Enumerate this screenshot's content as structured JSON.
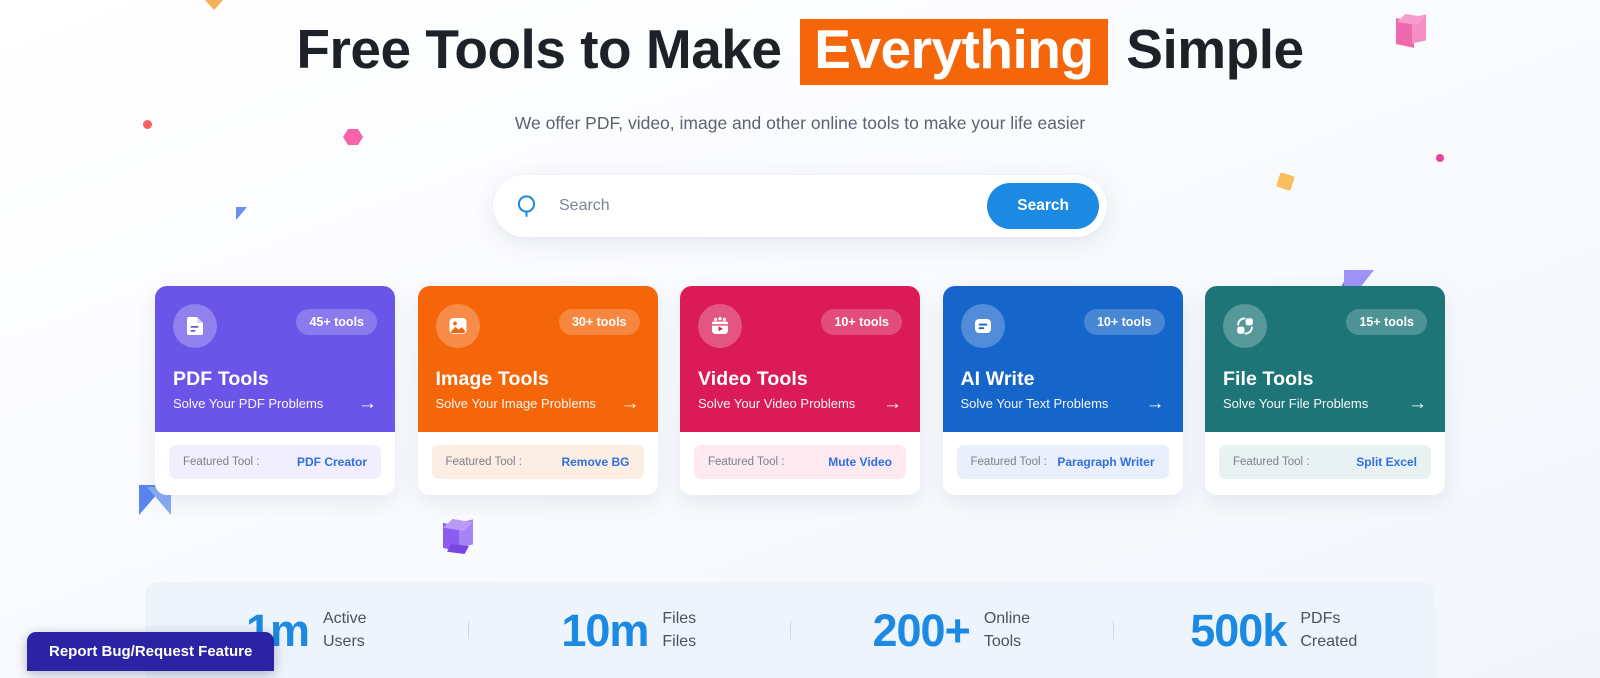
{
  "hero": {
    "headline_part1": "Free Tools to Make",
    "headline_highlight": "Everything",
    "headline_part2": "Simple",
    "subtitle": "We offer PDF, video, image and other online tools to make your life easier"
  },
  "search": {
    "placeholder": "Search",
    "button_label": "Search",
    "icon": "search-icon",
    "accent": "#1c8ae3"
  },
  "cards": [
    {
      "title": "PDF Tools",
      "subtitle": "Solve Your PDF Problems",
      "badge": "45+ tools",
      "featured_label": "Featured Tool :",
      "featured_value": "PDF Creator",
      "icon": "document-icon",
      "color": "#6b55e8",
      "foot_bg": "#f1effd",
      "foot_value_color": "#2f6fe0",
      "arrow": "→"
    },
    {
      "title": "Image Tools",
      "subtitle": "Solve Your Image Problems",
      "badge": "30+ tools",
      "featured_label": "Featured Tool :",
      "featured_value": "Remove BG",
      "icon": "image-icon",
      "color": "#f5650a",
      "foot_bg": "#fdeee3",
      "foot_value_color": "#2f6fe0",
      "arrow": "→"
    },
    {
      "title": "Video Tools",
      "subtitle": "Solve Your Video Problems",
      "badge": "10+ tools",
      "featured_label": "Featured Tool :",
      "featured_value": "Mute Video",
      "icon": "video-icon",
      "color": "#da1b57",
      "foot_bg": "#fdeaf0",
      "foot_value_color": "#2f6fe0",
      "arrow": "→"
    },
    {
      "title": "AI Write",
      "subtitle": "Solve Your Text Problems",
      "badge": "10+ tools",
      "featured_label": "Featured Tool :",
      "featured_value": "Paragraph Writer",
      "icon": "text-lines-icon",
      "color": "#1565cb",
      "foot_bg": "#e9f0fb",
      "foot_value_color": "#2f6fe0",
      "arrow": "→"
    },
    {
      "title": "File Tools",
      "subtitle": "Solve Your File Problems",
      "badge": "15+ tools",
      "featured_label": "Featured Tool :",
      "featured_value": "Split Excel",
      "icon": "file-convert-icon",
      "color": "#1d7578",
      "foot_bg": "#e8f2f3",
      "foot_value_color": "#2f6fe0",
      "arrow": "→"
    }
  ],
  "stats": [
    {
      "value": "1m",
      "label_line1": "Active",
      "label_line2": "Users"
    },
    {
      "value": "10m",
      "label_line1": "Files",
      "label_line2": "Files"
    },
    {
      "value": "200+",
      "label_line1": "Online",
      "label_line2": "Tools"
    },
    {
      "value": "500k",
      "label_line1": "PDFs",
      "label_line2": "Created"
    }
  ],
  "report_badge": {
    "label": "Report Bug/Request Feature",
    "color": "#2b23a3"
  },
  "decorations": [
    {
      "name": "orange-triangle",
      "color": "#f7b15b"
    },
    {
      "name": "red-dot",
      "color": "#fb5f5f"
    },
    {
      "name": "pink-hexagon",
      "color": "#f564a9"
    },
    {
      "name": "blue-triangle",
      "color": "#6b8cf0"
    },
    {
      "name": "pink-cube",
      "color": "#f26bb0"
    },
    {
      "name": "pink-dot",
      "color": "#ec3f97"
    },
    {
      "name": "orange-square",
      "color": "#fbbe5e"
    },
    {
      "name": "blue-pyramid",
      "color": "#6b95ef"
    },
    {
      "name": "purple-cube",
      "color": "#8b5cf0"
    },
    {
      "name": "purple-pyramid",
      "color": "#8a7cf0"
    }
  ]
}
